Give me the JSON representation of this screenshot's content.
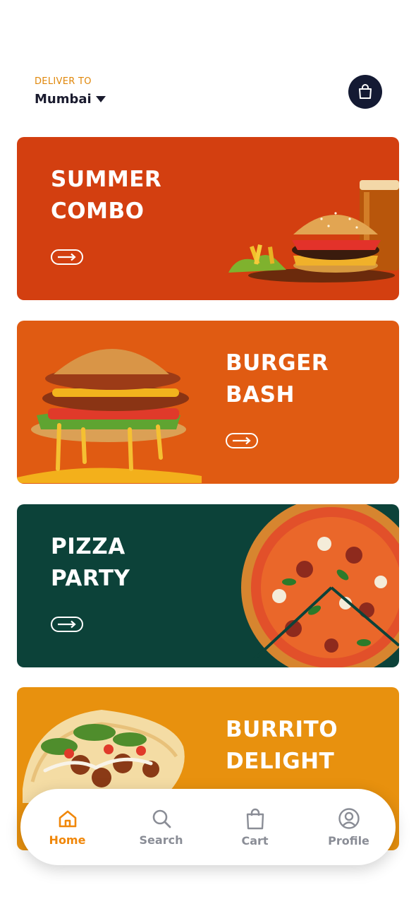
{
  "header": {
    "deliver_label": "DELIVER TO",
    "city": "Mumbai",
    "cart_icon": "shopping-bag-icon"
  },
  "cards": [
    {
      "title_line1": "SUMMER",
      "title_line2": "COMBO",
      "bg": "#d33f10",
      "image": "burger-combo-image"
    },
    {
      "title_line1": "BURGER",
      "title_line2": "BASH",
      "bg": "#e05b12",
      "image": "burger-image"
    },
    {
      "title_line1": "PIZZA",
      "title_line2": "PARTY",
      "bg": "#0c4239",
      "image": "pizza-image"
    },
    {
      "title_line1": "BURRITO",
      "title_line2": "DELIGHT",
      "bg": "#e8910e",
      "image": "taco-image"
    }
  ],
  "nav": {
    "items": [
      {
        "label": "Home",
        "icon": "home-icon",
        "active": true
      },
      {
        "label": "Search",
        "icon": "search-icon",
        "active": false
      },
      {
        "label": "Cart",
        "icon": "shopping-bag-icon",
        "active": false
      },
      {
        "label": "Profile",
        "icon": "profile-icon",
        "active": false
      }
    ]
  },
  "colors": {
    "accent": "#f0870a",
    "dark": "#141a33",
    "inactive": "#8a8d96"
  }
}
